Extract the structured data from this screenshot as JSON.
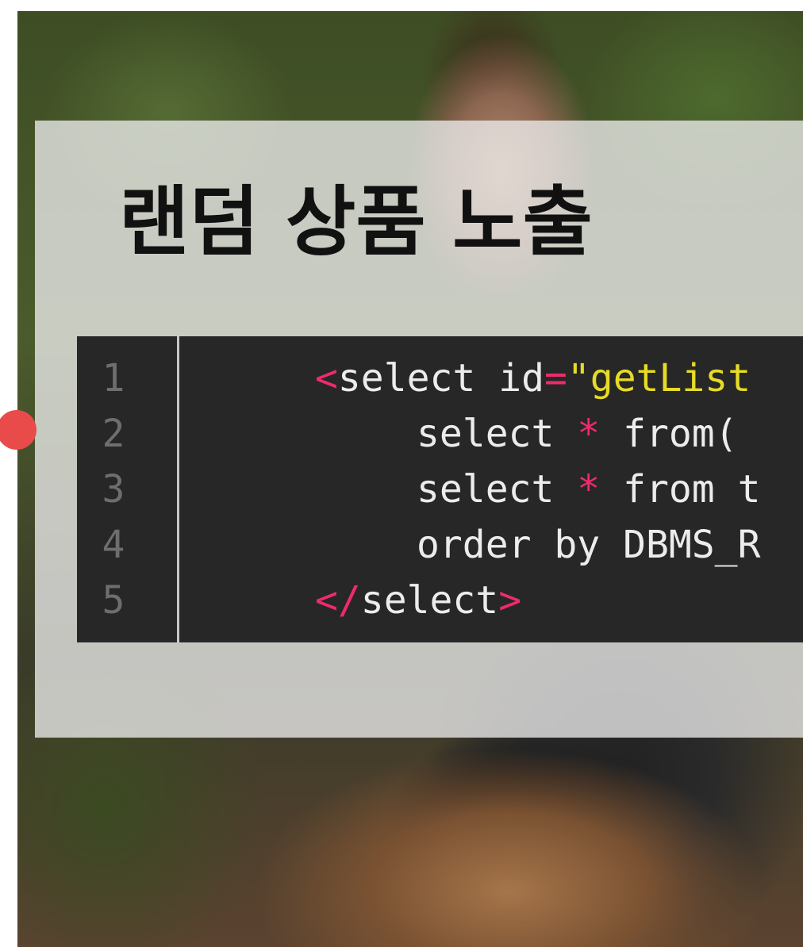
{
  "slide": {
    "title": "랜덤 상품 노출",
    "code": {
      "line_numbers": [
        "1",
        "2",
        "3",
        "4",
        "5"
      ],
      "lines": [
        {
          "open": "<",
          "keyword": "select",
          "attr": " id",
          "eq": "=",
          "value": "\"getList"
        },
        {
          "kw1": "select ",
          "star": "*",
          "rest": " from("
        },
        {
          "kw1": "select ",
          "star": "*",
          "rest": " from t"
        },
        {
          "text": "order by DBMS_R"
        },
        {
          "open": "</",
          "keyword": "select",
          "close": ">"
        }
      ]
    },
    "colors": {
      "tag": "#ee2b6c",
      "string": "#e6db26",
      "code_background": "#272727",
      "marker": "#e94b4b"
    }
  },
  "icons": {
    "marker": "red-dot"
  }
}
